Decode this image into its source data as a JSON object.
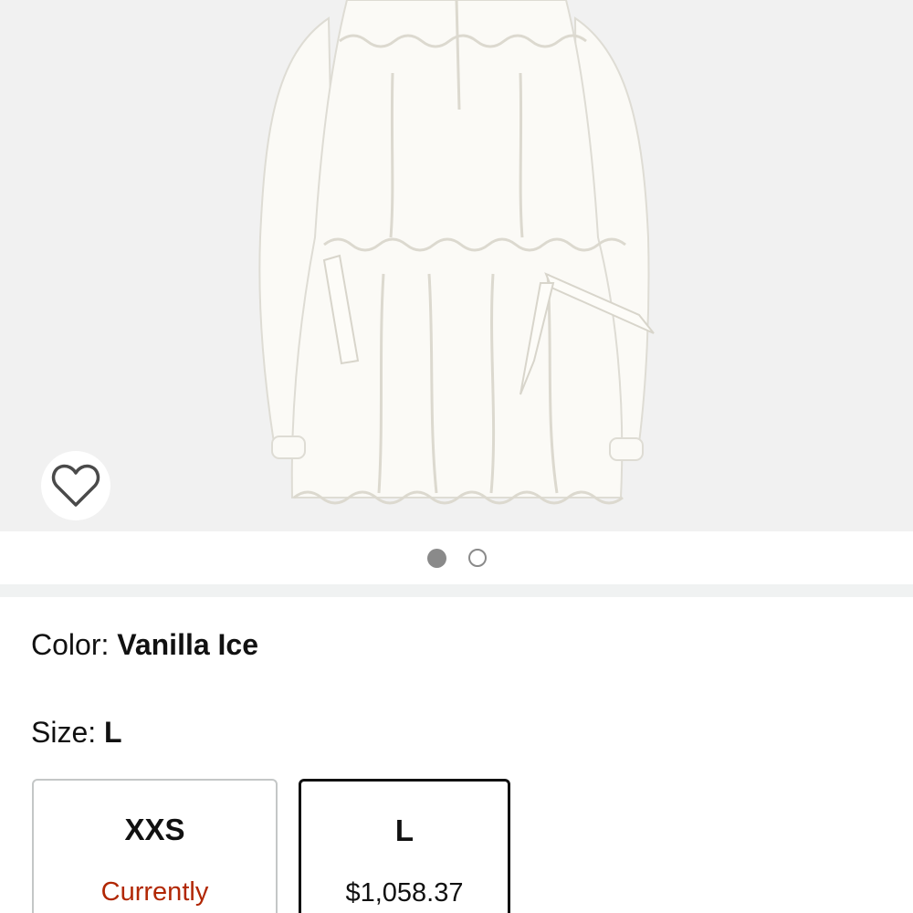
{
  "product": {
    "image_alt": "White ruffled drawstring mini dress",
    "image_count": 2,
    "active_image_index": 0
  },
  "icons": {
    "wishlist": "heart-outline-icon"
  },
  "color": {
    "label": "Color: ",
    "value": "Vanilla Ice"
  },
  "size": {
    "label": "Size: ",
    "value": "L",
    "options": [
      {
        "size": "XXS",
        "status": "Currently",
        "selected": false
      },
      {
        "size": "L",
        "price": "$1,058.37",
        "selected": true
      }
    ]
  },
  "colors": {
    "unavailable_text": "#b12704",
    "selected_border": "#111111",
    "tile_border": "#c4c7c7",
    "dot_active": "#8a8a8a"
  }
}
